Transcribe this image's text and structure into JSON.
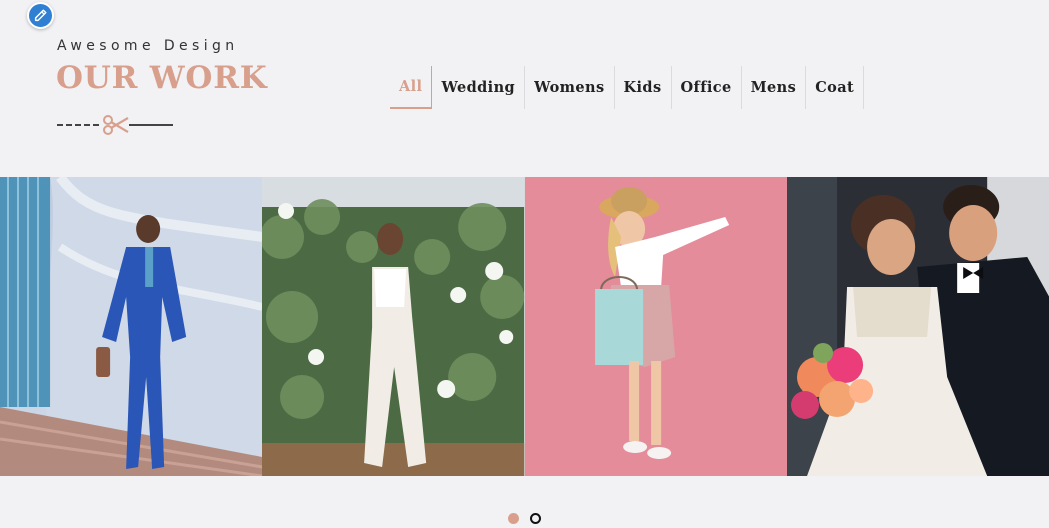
{
  "header": {
    "eyebrow": "Awesome Design",
    "title": "OUR WORK",
    "divider_icon": "scissors-icon"
  },
  "edit_button": {
    "icon": "pencil-icon"
  },
  "filters": [
    {
      "label": "All",
      "active": true
    },
    {
      "label": "Wedding",
      "active": false
    },
    {
      "label": "Womens",
      "active": false
    },
    {
      "label": "Kids",
      "active": false
    },
    {
      "label": "Office",
      "active": false
    },
    {
      "label": "Mens",
      "active": false
    },
    {
      "label": "Coat",
      "active": false
    }
  ],
  "gallery": [
    {
      "subject": "man in blue suit on stairs"
    },
    {
      "subject": "woman in white jumpsuit against green wall"
    },
    {
      "subject": "girl in straw hat with shopping bag"
    },
    {
      "subject": "wedding couple with bouquet"
    }
  ],
  "pagination": {
    "pages": 2,
    "current": 1
  },
  "colors": {
    "accent": "#d8a08c",
    "background": "#f2f1f4",
    "fab": "#2f7fd3",
    "text": "#222222"
  }
}
